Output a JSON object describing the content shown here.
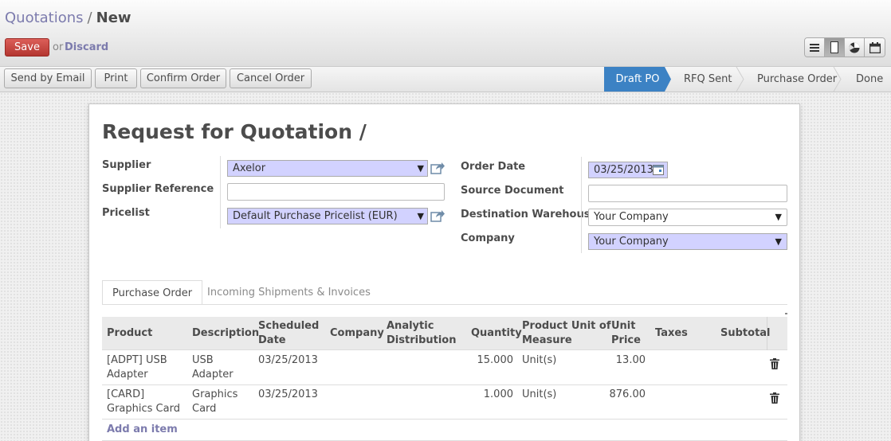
{
  "breadcrumb": {
    "parent": "Quotations",
    "separator": "/",
    "current": "New"
  },
  "form_actions": {
    "save_label": "Save",
    "or_text": "or",
    "discard_label": "Discard"
  },
  "views": [
    {
      "icon": "list-view-icon",
      "active": false
    },
    {
      "icon": "form-view-icon",
      "active": true
    },
    {
      "icon": "graph-view-icon",
      "active": false
    },
    {
      "icon": "calendar-view-icon",
      "active": false
    }
  ],
  "toolbar": {
    "buttons": [
      "Send by Email",
      "Print",
      "Confirm Order",
      "Cancel Order"
    ]
  },
  "status": {
    "stages": [
      "Draft PO",
      "RFQ Sent",
      "Purchase Order",
      "Done"
    ],
    "active_stage": "Draft PO"
  },
  "form": {
    "title": "Request for Quotation /",
    "left_labels": {
      "supplier": "Supplier",
      "supplier_reference": "Supplier Reference",
      "pricelist": "Pricelist"
    },
    "left_values": {
      "supplier": "Axelor",
      "supplier_reference": "",
      "pricelist": "Default Purchase Pricelist (EUR)"
    },
    "right_labels": {
      "order_date": "Order Date",
      "source_document": "Source Document",
      "destination_warehouse": "Destination Warehouse",
      "company": "Company"
    },
    "right_values": {
      "order_date": "03/25/2013",
      "source_document": "",
      "destination_warehouse": "Your Company",
      "company": "Your Company"
    }
  },
  "tabs": [
    {
      "label": "Purchase Order",
      "active": true
    },
    {
      "label": "Incoming Shipments & Invoices",
      "active": false
    }
  ],
  "order_lines": {
    "headers": {
      "product": "Product",
      "description": "Description",
      "scheduled_date_1": "Scheduled",
      "scheduled_date_2": "Date",
      "company": "Company",
      "analytic_1": "Analytic",
      "analytic_2": "Distribution",
      "quantity": "Quantity",
      "uom_1": "Product Unit of",
      "uom_2": "Measure",
      "unit_price_1": "Unit",
      "unit_price_2": "Price",
      "taxes": "Taxes",
      "subtotal": "Subtotal"
    },
    "rows": [
      {
        "product_1": "[ADPT] USB",
        "product_2": "Adapter",
        "description_1": "USB",
        "description_2": "Adapter",
        "scheduled_date": "03/25/2013",
        "company": "",
        "analytic": "",
        "quantity": "15.000",
        "uom": "Unit(s)",
        "unit_price": "13.00",
        "taxes": "",
        "subtotal": ""
      },
      {
        "product_1": "[CARD]",
        "product_2": "Graphics Card",
        "description_1": "Graphics",
        "description_2": "Card",
        "scheduled_date": "03/25/2013",
        "company": "",
        "analytic": "",
        "quantity": "1.000",
        "uom": "Unit(s)",
        "unit_price": "876.00",
        "taxes": "",
        "subtotal": ""
      }
    ],
    "add_item_label": "Add an item"
  }
}
